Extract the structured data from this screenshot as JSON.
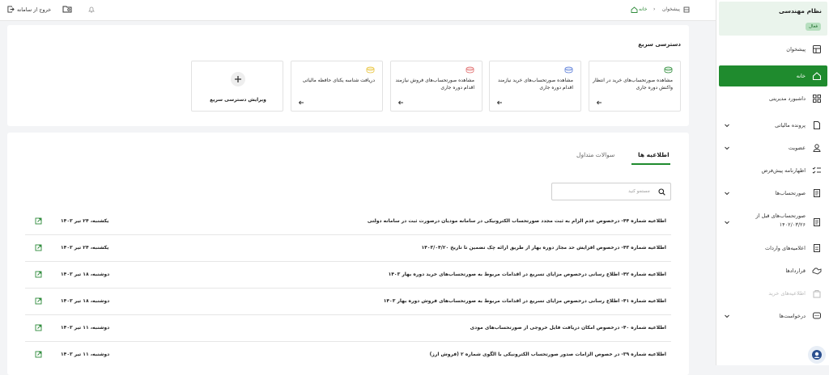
{
  "topbar": {
    "logout_label": "خروج از سامانه",
    "breadcrumb": [
      "پیشخوان",
      "خانه"
    ]
  },
  "sidebar": {
    "system_title": "نظام مهندسی",
    "status_badge": "فعال",
    "items": [
      {
        "label": "پیشخوان",
        "icon": "dashboard-icon"
      },
      {
        "label": "خانه",
        "icon": "home-icon",
        "active": true
      },
      {
        "label": "داشبورد مدیریتی",
        "icon": "grid-icon"
      },
      {
        "label": "پرونده مالیاتی",
        "icon": "file-icon"
      },
      {
        "label": "عضویت",
        "icon": "user-icon"
      },
      {
        "label": "اظهارنامه پیش‌فرض",
        "icon": "checklist-icon"
      },
      {
        "label": "صورتحساب‌ها",
        "icon": "invoice-icon"
      },
      {
        "label": "صورتحساب‌های قبل از",
        "label2": "۱۴۰۲/۰۳/۲۶",
        "icon": "invoice-old-icon"
      },
      {
        "label": "اعلامیه‌های واردات",
        "icon": "import-icon"
      },
      {
        "label": "قراردادها",
        "icon": "handshake-icon"
      },
      {
        "label": "اطلاعیه‌های خرید",
        "icon": "bag-icon",
        "disabled": true
      },
      {
        "label": "درخواست‌ها",
        "icon": "message-icon"
      }
    ]
  },
  "quick_access": {
    "title": "دسترسی سریع",
    "tiles": [
      {
        "text": "مشاهده صورتحساب‌های خرید در انتظار واکنش دوره جاری",
        "icon_color": "#2e8b3a"
      },
      {
        "text": "مشاهده صورتحساب‌های خرید نیازمند اقدام دوره جاری",
        "icon_color": "#5b7dd8"
      },
      {
        "text": "مشاهده صورتحساب‌های فروش نیازمند اقدام دوره جاری",
        "icon_color": "#e06b6b"
      },
      {
        "text": "دریافت شناسه یکتای حافظه مالیاتی",
        "icon_color": "#e8c33a"
      }
    ],
    "edit_label": "ویرایش دسترسی سریع"
  },
  "announcements": {
    "tabs": [
      "اطلاعیه ها",
      "سوالات متداول"
    ],
    "search_placeholder": "جستجو کنید",
    "rows": [
      {
        "title": "اطلاعیه شماره ۴۴- درخصوص عدم الزام به ثبت مجدد صورتحساب الکترونیکی در سامانه مودیان درصورت ثبت در سامانه دولتی",
        "date": "یکشنبه، ۲۴ تیر ۱۴۰۳"
      },
      {
        "title": "اطلاعیه شماره ۴۳- درخصوص افزایش حد مجاز دوره بهار از طریق ارائه چک تضمین تا تاریخ ۱۴۰۳/۰۴/۲۰",
        "date": "یکشنبه، ۲۴ تیر ۱۴۰۳"
      },
      {
        "title": "اطلاعیه شماره ۴۲- اطلاع رسانی درخصوص مزایای تسریع در اقدامات مربوط به صورتحساب‌های خرید دوره بهار ۱۴۰۳",
        "date": "دوشنبه، ۱۸ تیر ۱۴۰۳"
      },
      {
        "title": "اطلاعیه شماره ۴۱- اطلاع رسانی درخصوص مزایای تسریع در اقدامات مربوط به صورتحساب‌های فروش دوره بهار ۱۴۰۳",
        "date": "دوشنبه، ۱۸ تیر ۱۴۰۳"
      },
      {
        "title": "اطلاعیه شماره ۴۰- درخصوص امکان دریافت فایل خروجی از صورتحساب‌های مودی",
        "date": "دوشنبه، ۱۱ تیر ۱۴۰۳"
      },
      {
        "title": "اطلاعیه شماره ۳۹- در خصوص الزامات صدور صورتحساب الکترونیکی با الگوی شماره ۲ (فروش ارز)",
        "date": "دوشنبه، ۱۱ تیر ۱۴۰۳"
      }
    ]
  },
  "colors": {
    "accent": "#1f8b2e",
    "accent_light": "#eaf4ec"
  }
}
